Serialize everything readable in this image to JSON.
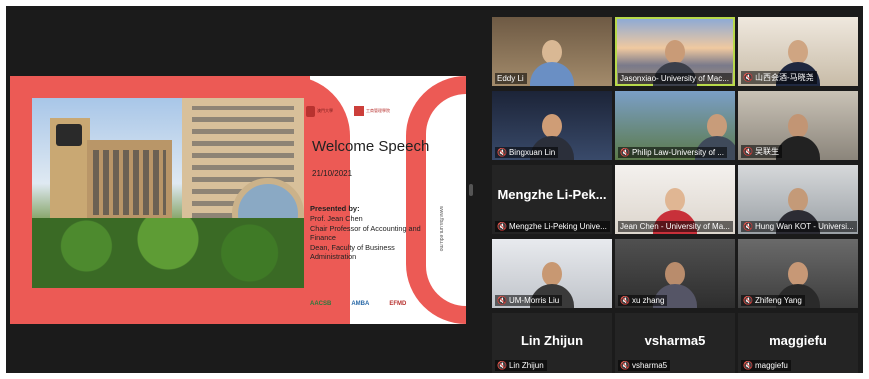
{
  "slide": {
    "logo1_text": "澳門大學",
    "logo2_text": "工商管理學院",
    "title": "Welcome Speech",
    "date": "21/10/2021",
    "presented_by": "Presented by:",
    "lines": [
      "Prof. Jean Chen",
      "Chair Professor of Accounting and Finance",
      "Dean, Faculty of Business Administration"
    ],
    "accreditations": [
      "AACSB",
      "AMBA",
      "EFMD"
    ],
    "url": "www.fba.um.edu.mo"
  },
  "participants": [
    {
      "name": "Eddy Li",
      "muted": false
    },
    {
      "name": "Jasonxiao- University of Mac...",
      "muted": false,
      "active": true
    },
    {
      "name": "山西会酒-马晓尧",
      "muted": true
    },
    {
      "name": "Bingxuan Lin",
      "muted": true
    },
    {
      "name": "Philip Law-University of ...",
      "muted": true
    },
    {
      "name": "吴联生",
      "muted": true
    },
    {
      "name": "Mengzhe Li-Peking Unive...",
      "muted": true,
      "display_text": "Mengzhe  Li-Pek..."
    },
    {
      "name": "Jean Chen - University of Ma...",
      "muted": false
    },
    {
      "name": "Hung Wan KOT - Universi...",
      "muted": true
    },
    {
      "name": "UM-Morris Liu",
      "muted": true
    },
    {
      "name": "xu zhang",
      "muted": true
    },
    {
      "name": "Zhifeng Yang",
      "muted": true
    },
    {
      "name": "Lin Zhijun",
      "muted": true,
      "display_text": "Lin Zhijun"
    },
    {
      "name": "vsharma5",
      "muted": true,
      "display_text": "vsharma5"
    },
    {
      "name": "maggiefu",
      "muted": true,
      "display_text": "maggiefu"
    }
  ],
  "colors": {
    "accent_border": "#b8d94a",
    "mic_muted": "#e24a3b",
    "slide_red": "#ec5a55"
  }
}
